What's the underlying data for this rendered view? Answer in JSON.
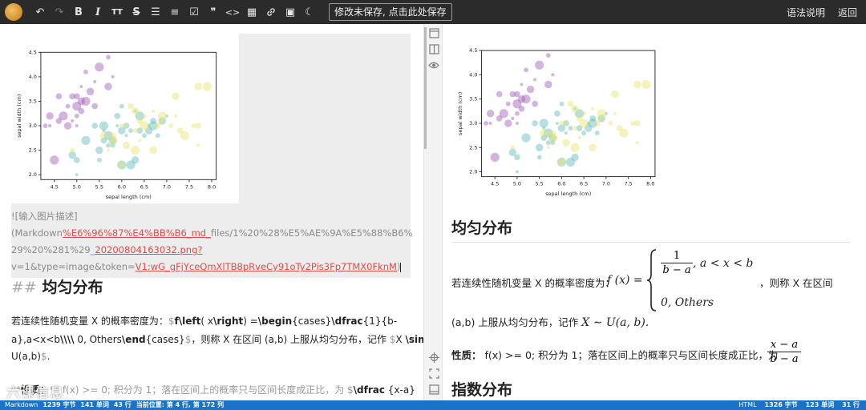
{
  "toolbar": {
    "save_label": "修改未保存, 点击此处保存",
    "syntax_label": "语法说明",
    "back_label": "返回",
    "icons": [
      "undo-icon",
      "redo-icon",
      "bold-icon",
      "italic-icon",
      "heading-icon",
      "strikethrough-icon",
      "unordered-list-icon",
      "ordered-list-icon",
      "task-list-icon",
      "quote-icon",
      "code-icon",
      "table-icon",
      "link-icon",
      "image-icon",
      "moon-icon"
    ],
    "glyphs": {
      "undo": "↶",
      "redo": "↷",
      "bold": "B",
      "italic": "I",
      "heading": "TT",
      "strike": "S",
      "ul": "☰",
      "ol": "≡",
      "task": "☑",
      "quote": "❞",
      "code": "<>",
      "table": "▦",
      "link": "🔗",
      "image": "▣",
      "moon": "☾"
    }
  },
  "editor": {
    "img_line1": "![输入图片描述]",
    "img_line2a": "(Markdown",
    "img_line2b": "%E6%96%87%E4%BB%B6",
    "img_line2c": "_md_",
    "img_line2d": "files/1%20%28%E5%AE%9A%E5%88%B6%",
    "img_line3a": "29%20%281%29_",
    "img_line3b": "20200804163032.png?",
    "img_line4a": "v=1&type=image&token=",
    "img_line4b": "V1:wG_gFjYceQmXlTB8pRveCy91oTy2Pis3Fp7TMX0FknM",
    "img_line4c": ")",
    "heading_hash": "##",
    "heading_text": "均匀分布",
    "p1_line1a": "若连续性随机变量 X 的概率密度为：",
    "p1_line1b": "$",
    "p1_line1c": "f",
    "p1_line1d": "\\left",
    "p1_line1e": "( x",
    "p1_line1f": "\\right",
    "p1_line1g": ") =",
    "p1_line1h": "\\begin",
    "p1_line1i": "{cases}",
    "p1_line1j": "\\dfrac",
    "p1_line1k": "{1}{b-",
    "p1_line2a": "a},a<x<b",
    "p1_line2b": "\\\\\\\\",
    "p1_line2c": " 0, Others",
    "p1_line2d": "\\end",
    "p1_line2e": "{cases}",
    "p1_line2f": "$",
    "p1_line2g": "，则称 X 在区间 (a,b) 上服从均匀分布，记作",
    "p1_line2h": " $",
    "p1_line2i": "X ",
    "p1_line2j": "\\sim",
    "p1_line3a": "U(a,b)",
    "p1_line3b": "$",
    "p1_line3c": ".",
    "p2a": "**",
    "p2b": "性质：",
    "p2c": "** f(x) >= 0; 积分为 1；落在区间上的概率只与区间长度成正比，为",
    "p2d": " $",
    "p2e": "\\dfrac",
    "p2f": " {x-a}"
  },
  "preview": {
    "heading1": "均匀分布",
    "p1_prefix": "若连续性随机变量 X 的概率密度为：",
    "fx": "f (x) =",
    "case1_num": "1",
    "case1_den": "b − a",
    "case1_cond": ", a < x < b",
    "case2": "0, Others",
    "p1_suffix": "，则称 X 在区间",
    "p1_line2": "(a,b) 上服从均匀分布，记作",
    "p1_math2": "X ∼ U(a, b).",
    "prop_label": "性质：",
    "prop_text": "f(x) >= 0; 积分为 1；落在区间上的概率只与区间长度成正比，为",
    "frac_num": "x − a",
    "frac_den": "b − a",
    "heading2": "指数分布"
  },
  "chart_data": {
    "type": "scatter",
    "xlabel": "sepal length (cm)",
    "ylabel": "sepal width (cm)",
    "xlim": [
      4.2,
      8.1
    ],
    "ylim": [
      1.9,
      4.5
    ],
    "xticks": [
      "4.5",
      "5.0",
      "5.5",
      "6.0",
      "6.5",
      "7.0",
      "7.5",
      "8.0"
    ],
    "yticks": [
      "2.0",
      "2.5",
      "3.0",
      "3.5",
      "4.0",
      "4.5"
    ],
    "series": [
      {
        "color": "#9b59b6",
        "points": [
          [
            4.4,
            3.0
          ],
          [
            4.6,
            3.1
          ],
          [
            4.7,
            3.2
          ],
          [
            4.8,
            3.4
          ],
          [
            4.8,
            3.0
          ],
          [
            4.9,
            3.1
          ],
          [
            5.0,
            3.6
          ],
          [
            5.0,
            3.4
          ],
          [
            5.0,
            3.2
          ],
          [
            5.1,
            3.5
          ],
          [
            5.1,
            3.8
          ],
          [
            5.1,
            3.3
          ],
          [
            5.2,
            3.5
          ],
          [
            5.2,
            4.1
          ],
          [
            5.3,
            3.7
          ],
          [
            5.4,
            3.9
          ],
          [
            5.4,
            3.4
          ],
          [
            5.5,
            4.2
          ],
          [
            5.7,
            4.4
          ],
          [
            5.7,
            3.8
          ],
          [
            5.8,
            4.0
          ],
          [
            4.6,
            3.6
          ],
          [
            4.5,
            2.3
          ],
          [
            4.3,
            3.0
          ],
          [
            4.4,
            3.2
          ],
          [
            5.0,
            3.0
          ],
          [
            4.9,
            3.6
          ]
        ]
      },
      {
        "color": "#5fb7b7",
        "points": [
          [
            4.9,
            2.4
          ],
          [
            5.0,
            2.0
          ],
          [
            5.0,
            2.3
          ],
          [
            5.2,
            2.7
          ],
          [
            5.5,
            2.3
          ],
          [
            5.5,
            2.5
          ],
          [
            5.6,
            2.9
          ],
          [
            5.6,
            2.7
          ],
          [
            5.7,
            2.8
          ],
          [
            5.7,
            2.6
          ],
          [
            5.8,
            2.7
          ],
          [
            5.9,
            3.0
          ],
          [
            5.9,
            3.2
          ],
          [
            6.0,
            2.2
          ],
          [
            6.0,
            3.4
          ],
          [
            6.0,
            2.9
          ],
          [
            6.1,
            2.8
          ],
          [
            6.1,
            3.0
          ],
          [
            6.2,
            2.2
          ],
          [
            6.2,
            2.9
          ],
          [
            6.3,
            2.3
          ],
          [
            6.3,
            3.3
          ],
          [
            6.4,
            2.9
          ],
          [
            6.4,
            3.2
          ],
          [
            6.5,
            2.8
          ],
          [
            6.6,
            2.9
          ],
          [
            6.6,
            3.0
          ],
          [
            6.7,
            3.1
          ],
          [
            6.7,
            3.0
          ],
          [
            6.8,
            2.8
          ],
          [
            6.9,
            3.1
          ],
          [
            7.0,
            3.2
          ],
          [
            5.4,
            3.0
          ],
          [
            5.6,
            3.0
          ],
          [
            5.8,
            2.6
          ]
        ]
      },
      {
        "color": "#e8e46a",
        "points": [
          [
            4.9,
            2.5
          ],
          [
            5.6,
            2.8
          ],
          [
            5.7,
            2.5
          ],
          [
            5.8,
            2.8
          ],
          [
            5.8,
            2.7
          ],
          [
            6.0,
            3.0
          ],
          [
            6.0,
            2.2
          ],
          [
            6.1,
            3.0
          ],
          [
            6.2,
            3.4
          ],
          [
            6.3,
            2.5
          ],
          [
            6.3,
            2.9
          ],
          [
            6.3,
            3.3
          ],
          [
            6.4,
            2.7
          ],
          [
            6.4,
            3.1
          ],
          [
            6.5,
            3.0
          ],
          [
            6.5,
            3.2
          ],
          [
            6.7,
            2.5
          ],
          [
            6.7,
            3.3
          ],
          [
            6.8,
            3.0
          ],
          [
            6.9,
            3.2
          ],
          [
            7.1,
            3.0
          ],
          [
            7.2,
            3.6
          ],
          [
            7.2,
            3.2
          ],
          [
            7.3,
            2.9
          ],
          [
            7.4,
            2.8
          ],
          [
            7.6,
            3.0
          ],
          [
            7.7,
            3.8
          ],
          [
            7.7,
            2.6
          ],
          [
            7.7,
            3.0
          ],
          [
            7.9,
            3.8
          ],
          [
            6.9,
            3.1
          ],
          [
            6.1,
            2.6
          ]
        ]
      }
    ]
  },
  "status": {
    "mode": "Markdown",
    "chars": "1239 字节",
    "words": "141 单词",
    "lines": "43 行",
    "cursor": "当前位置: 第 4 行, 第 172 列",
    "format": "HTML",
    "r_chars": "1326 字节",
    "r_words": "123 单词",
    "r_lines": "31 行"
  },
  "watermark": "六课信息"
}
